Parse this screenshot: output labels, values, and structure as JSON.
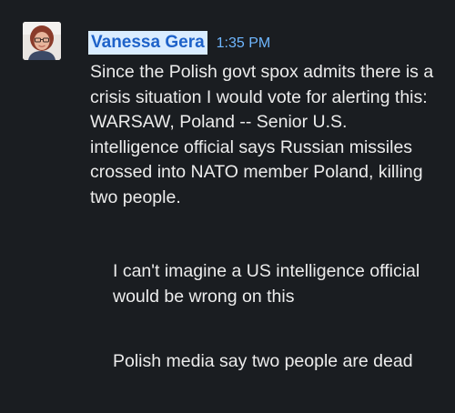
{
  "message": {
    "author": "Vanessa Gera",
    "time": "1:35 PM",
    "text": "Since the Polish govt spox admits there is a crisis situation I would vote for alerting this: WARSAW, Poland -- Senior U.S. intelligence official says Russian missiles crossed into NATO member Poland, killing two people."
  },
  "followups": [
    {
      "text": "I can't imagine a US intelligence official would be wrong on this"
    },
    {
      "text": "Polish media say two people are dead"
    }
  ],
  "colors": {
    "background": "#1a1d21",
    "author_highlight": "#d9ecff",
    "author_text": "#1e62c9",
    "timestamp": "#6fb7ff",
    "text": "#ececec"
  },
  "icons": {
    "avatar": "user-avatar-photo"
  }
}
